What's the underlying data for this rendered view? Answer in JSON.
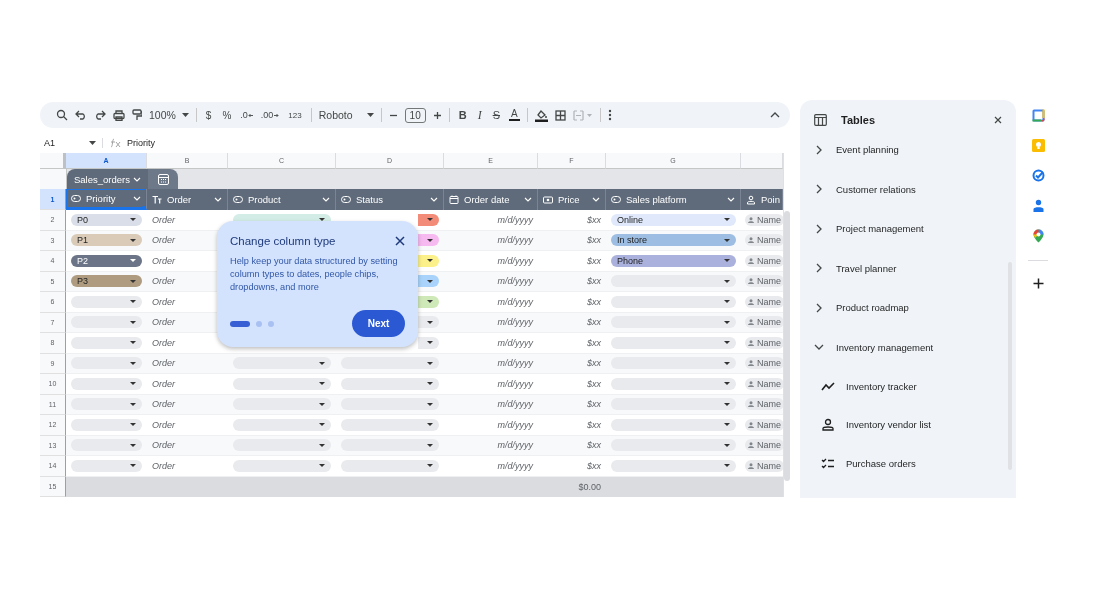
{
  "toolbar": {
    "zoom": "100%",
    "currency": "$",
    "percent": "%",
    "decrease_decimals": ".0",
    "increase_decimals": ".00",
    "number_format": "123",
    "font": "Roboto",
    "font_size": "10",
    "bold": "B",
    "italic": "I",
    "strikethrough": "S",
    "text_color": "A"
  },
  "name_box": "A1",
  "formula": "Priority",
  "columns": [
    {
      "letter": "A",
      "selected": true
    },
    {
      "letter": "B",
      "selected": false
    },
    {
      "letter": "C",
      "selected": false
    },
    {
      "letter": "D",
      "selected": false
    },
    {
      "letter": "E",
      "selected": false
    },
    {
      "letter": "F",
      "selected": false
    },
    {
      "letter": "G",
      "selected": false
    }
  ],
  "table": {
    "name": "Sales_orders",
    "header_row": "1",
    "headers": [
      {
        "label": "Priority",
        "kind": "dropdown",
        "selected": true
      },
      {
        "label": "Order",
        "kind": "text",
        "selected": false
      },
      {
        "label": "Product",
        "kind": "dropdown",
        "selected": false
      },
      {
        "label": "Status",
        "kind": "dropdown",
        "selected": false
      },
      {
        "label": "Order date",
        "kind": "date",
        "selected": false
      },
      {
        "label": "Price",
        "kind": "currency",
        "selected": false
      },
      {
        "label": "Sales platform",
        "kind": "dropdown",
        "selected": false
      },
      {
        "label": "Poin",
        "kind": "person",
        "selected": false
      }
    ],
    "rows": [
      {
        "number": "2",
        "priority": {
          "label": "P0",
          "color": "#d9dee8"
        },
        "order": "Order",
        "product": {
          "color": "#d3ece6"
        },
        "status": {
          "color": "#f28b78"
        },
        "date": "m/d/yyyy",
        "price": "$xx",
        "platform": {
          "label": "Online",
          "color": "#dfe9fb"
        },
        "person": "Name"
      },
      {
        "number": "3",
        "priority": {
          "label": "P1",
          "color": "#dacbb8"
        },
        "order": "Order",
        "status": {
          "color": "#f6b9f0"
        },
        "date": "m/d/yyyy",
        "price": "$xx",
        "platform": {
          "label": "In store",
          "color": "#9dbde2"
        },
        "person": "Name"
      },
      {
        "number": "4",
        "priority": {
          "label": "P2",
          "color": "#6c7587"
        },
        "order": "Order",
        "status": {
          "color": "#fbf08a"
        },
        "date": "m/d/yyyy",
        "price": "$xx",
        "platform": {
          "label": "Phone",
          "color": "#aab1dc"
        },
        "person": "Name"
      },
      {
        "number": "5",
        "priority": {
          "label": "P3",
          "color": "#ae9b80"
        },
        "order": "Order",
        "status": {
          "color": "#a9d3fb"
        },
        "date": "m/d/yyyy",
        "price": "$xx",
        "platform": {
          "color": "#e8eaed"
        },
        "person": "Name"
      },
      {
        "number": "6",
        "priority": {
          "color": "#e8eaed"
        },
        "order": "Order",
        "status": {
          "color": "#cfe8b8"
        },
        "date": "m/d/yyyy",
        "price": "$xx",
        "platform": {
          "color": "#e8eaed"
        },
        "person": "Name"
      },
      {
        "number": "7",
        "priority": {
          "color": "#e8eaed"
        },
        "order": "Order",
        "status": {
          "color": "#e8eaed"
        },
        "date": "m/d/yyyy",
        "price": "$xx",
        "platform": {
          "color": "#e8eaed"
        },
        "person": "Name"
      },
      {
        "number": "8",
        "priority": {
          "color": "#e8eaed"
        },
        "order": "Order",
        "status": {
          "color": "#e8eaed"
        },
        "date": "m/d/yyyy",
        "price": "$xx",
        "platform": {
          "color": "#e8eaed"
        },
        "person": "Name"
      },
      {
        "number": "9",
        "priority": {
          "color": "#e8eaed"
        },
        "order": "Order",
        "product": {
          "color": "#e8eaed"
        },
        "status": {
          "color": "#e8eaed"
        },
        "date": "m/d/yyyy",
        "price": "$xx",
        "platform": {
          "color": "#e8eaed"
        },
        "person": "Name"
      },
      {
        "number": "10",
        "priority": {
          "color": "#e8eaed"
        },
        "order": "Order",
        "product": {
          "color": "#e8eaed"
        },
        "status": {
          "color": "#e8eaed"
        },
        "date": "m/d/yyyy",
        "price": "$xx",
        "platform": {
          "color": "#e8eaed"
        },
        "person": "Name"
      },
      {
        "number": "11",
        "priority": {
          "color": "#e8eaed"
        },
        "order": "Order",
        "product": {
          "color": "#e8eaed"
        },
        "status": {
          "color": "#e8eaed"
        },
        "date": "m/d/yyyy",
        "price": "$xx",
        "platform": {
          "color": "#e8eaed"
        },
        "person": "Name"
      },
      {
        "number": "12",
        "priority": {
          "color": "#e8eaed"
        },
        "order": "Order",
        "product": {
          "color": "#e8eaed"
        },
        "status": {
          "color": "#e8eaed"
        },
        "date": "m/d/yyyy",
        "price": "$xx",
        "platform": {
          "color": "#e8eaed"
        },
        "person": "Name"
      },
      {
        "number": "13",
        "priority": {
          "color": "#e8eaed"
        },
        "order": "Order",
        "product": {
          "color": "#e8eaed"
        },
        "status": {
          "color": "#e8eaed"
        },
        "date": "m/d/yyyy",
        "price": "$xx",
        "platform": {
          "color": "#e8eaed"
        },
        "person": "Name"
      },
      {
        "number": "14",
        "priority": {
          "color": "#e8eaed"
        },
        "order": "Order",
        "product": {
          "color": "#e8eaed"
        },
        "status": {
          "color": "#e8eaed"
        },
        "date": "m/d/yyyy",
        "price": "$xx",
        "platform": {
          "color": "#e8eaed"
        },
        "person": "Name"
      }
    ],
    "footer": {
      "number": "15",
      "price_total": "$0.00"
    }
  },
  "popup": {
    "title": "Change column type",
    "body": "Help keep your data structured by setting column types to dates, people chips, dropdowns, and more",
    "steps": [
      {
        "selected": true
      },
      {
        "selected": false
      },
      {
        "selected": false
      }
    ],
    "button": "Next"
  },
  "side_panel": {
    "title": "Tables",
    "items": [
      {
        "label": "Event planning",
        "expanded": false
      },
      {
        "label": "Customer relations",
        "expanded": false
      },
      {
        "label": "Project management",
        "expanded": false
      },
      {
        "label": "Travel planner",
        "expanded": false
      },
      {
        "label": "Product roadmap",
        "expanded": false
      },
      {
        "label": "Inventory management",
        "expanded": true,
        "children": [
          {
            "label": "Inventory tracker",
            "kind": "trend"
          },
          {
            "label": "Inventory vendor list",
            "kind": "person"
          },
          {
            "label": "Purchase orders",
            "kind": "checklist"
          }
        ]
      }
    ]
  }
}
